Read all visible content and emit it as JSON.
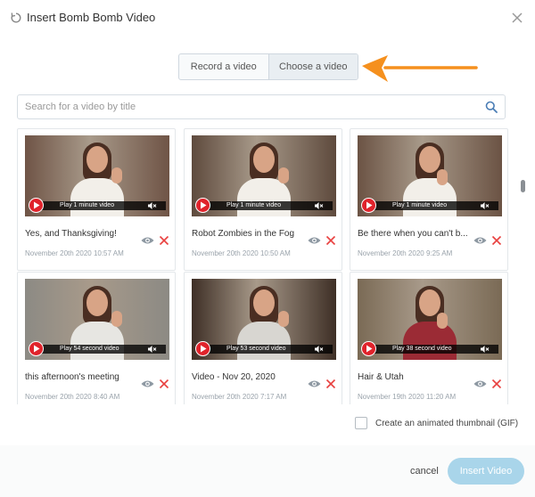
{
  "header": {
    "title": "Insert Bomb Bomb Video",
    "logo_icon": "bombbomb-refresh-icon",
    "close_icon": "close-icon"
  },
  "tabs": [
    {
      "label": "Record a video",
      "active": false
    },
    {
      "label": "Choose a video",
      "active": true
    }
  ],
  "annotation": {
    "arrow_color": "#f5901e"
  },
  "search": {
    "placeholder": "Search for a video by title",
    "icon": "search-icon"
  },
  "videos": [
    {
      "title": "Yes, and Thanksgiving!",
      "date": "November 20th 2020 10:57 AM",
      "duration_label": "Play 1 minute video",
      "palette": {
        "bg": "#6f5446",
        "shirt": "#f2efe9"
      }
    },
    {
      "title": "Robot Zombies in the Fog",
      "date": "November 20th 2020 10:50 AM",
      "duration_label": "Play 1 minute video",
      "palette": {
        "bg": "#5e4a3d",
        "shirt": "#f2efe9"
      }
    },
    {
      "title": "Be there when you can't b...",
      "date": "November 20th 2020 9:25 AM",
      "duration_label": "Play 1 minute video",
      "palette": {
        "bg": "#6b5344",
        "shirt": "#f2efe9"
      }
    },
    {
      "title": "this afternoon's meeting",
      "date": "November 20th 2020 8:40 AM",
      "duration_label": "Play 54 second video",
      "palette": {
        "bg": "#8c8a84",
        "shirt": "#e7e6e2"
      }
    },
    {
      "title": "Video - Nov 20, 2020",
      "date": "November 20th 2020 7:17 AM",
      "duration_label": "Play 53 second video",
      "palette": {
        "bg": "#3e2f26",
        "shirt": "#d8d6d1"
      }
    },
    {
      "title": "Hair & Utah",
      "date": "November 19th 2020 11:20 AM",
      "duration_label": "Play 38 second video",
      "palette": {
        "bg": "#7a6a55",
        "shirt": "#9b2b35"
      }
    }
  ],
  "options": {
    "gif_label": "Create an animated thumbnail (GIF)",
    "gif_checked": false
  },
  "footer": {
    "cancel_label": "cancel",
    "insert_label": "Insert Video"
  }
}
